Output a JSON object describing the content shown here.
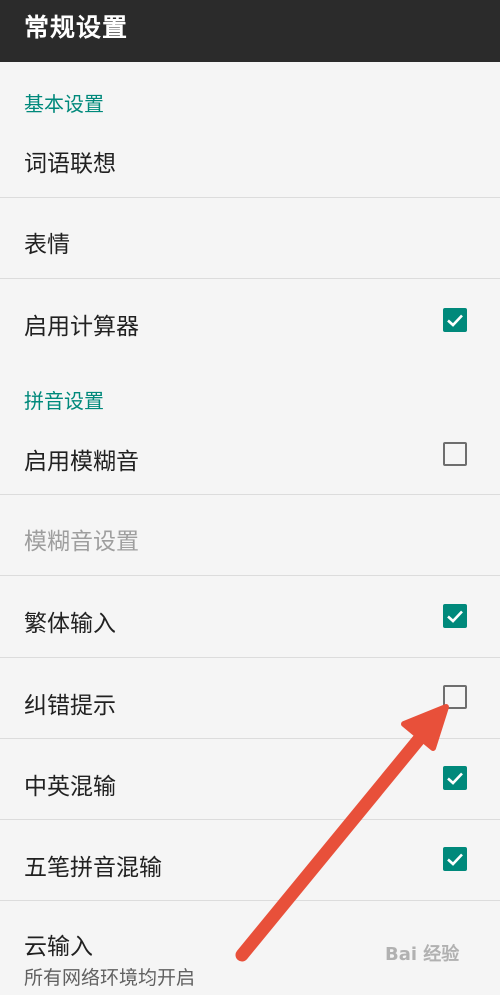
{
  "header": {
    "title": "常规设置"
  },
  "sections": {
    "basic": "基本设置",
    "pinyin": "拼音设置"
  },
  "items": {
    "word_association": {
      "label": "词语联想"
    },
    "emoji": {
      "label": "表情"
    },
    "calculator": {
      "label": "启用计算器",
      "checked": true
    },
    "fuzzy": {
      "label": "启用模糊音",
      "checked": false
    },
    "fuzzy_settings": {
      "label": "模糊音设置",
      "enabled": false
    },
    "traditional": {
      "label": "繁体输入",
      "checked": true
    },
    "correction": {
      "label": "纠错提示",
      "checked": false
    },
    "cn_en_mix": {
      "label": "中英混输",
      "checked": true
    },
    "wubi_pinyin_mix": {
      "label": "五笔拼音混输",
      "checked": true
    },
    "cloud_input": {
      "label": "云输入",
      "summary": "所有网络环境均开启"
    }
  },
  "watermark": "Bai 经验",
  "colors": {
    "accent": "#00897b",
    "title_bar": "#2b2b2b",
    "arrow": "#e8503a"
  }
}
